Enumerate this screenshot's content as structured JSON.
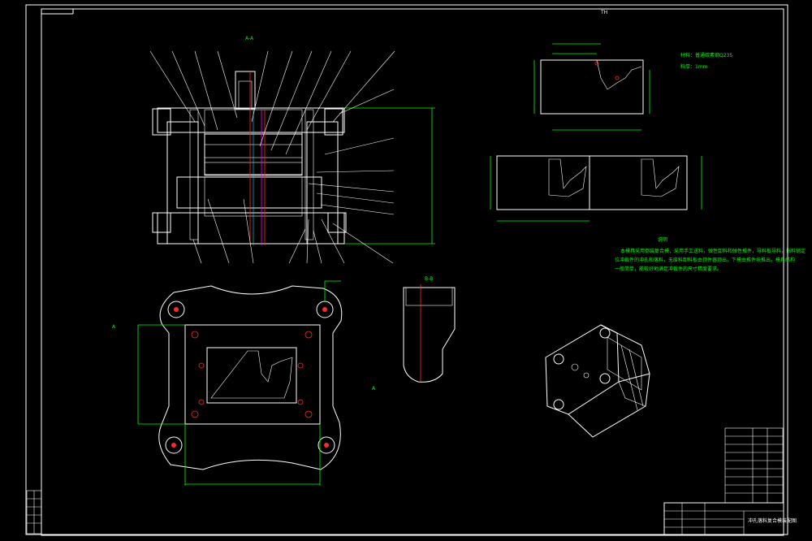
{
  "sheet": {
    "top_label": "TH",
    "section_label": "A-A",
    "detail_label": "B-B",
    "material_note": "材料：普通碳素钢Q235",
    "thickness_note": "料厚：1mm",
    "notes_title": "说明",
    "notes_lines": [
      "本模具采用倒装复合模，采用手工送料，弹性卸料和弹性推件，导料板导料，挡料销定",
      "位冲裁件的冲孔和落料，无废料卸料板由顶件器顶出，下模由推件块推出，模具结构",
      "一般简单，能较好地满足冲裁件的尺寸精度要求。"
    ],
    "title_block_name": "冲孔落料复合模装配图",
    "colors": {
      "background": "#000000",
      "outline": "#ffffff",
      "dimension": "#00ff00",
      "center": "#ff2a2a",
      "hatch": "#00e5ff",
      "accent": "#ffff00"
    }
  }
}
